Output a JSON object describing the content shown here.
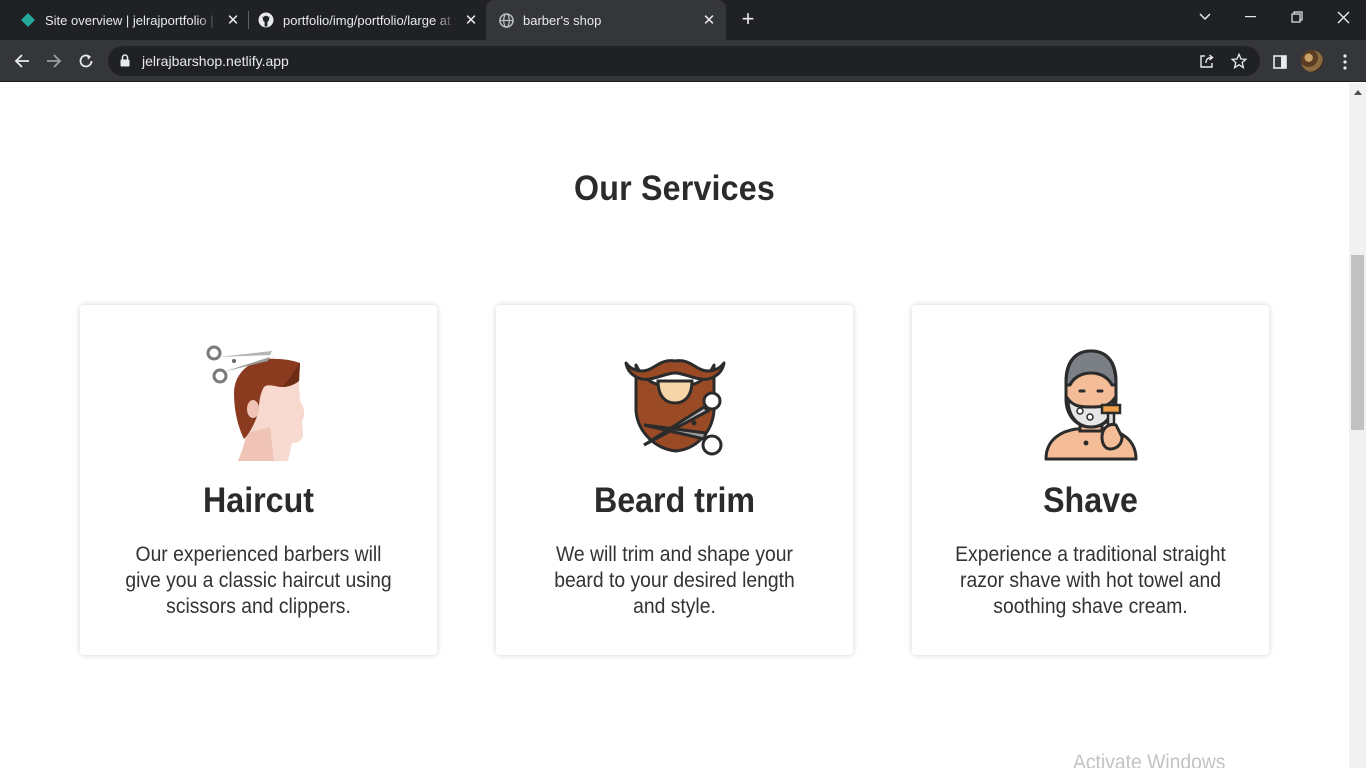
{
  "browser": {
    "tabs": [
      {
        "title": "Site overview | jelrajportfolio | Netlify",
        "icon": "netlify-icon",
        "active": false
      },
      {
        "title": "portfolio/img/portfolio/large at main",
        "icon": "github-icon",
        "active": false
      },
      {
        "title": "barber's shop",
        "icon": "globe-icon",
        "active": true
      }
    ],
    "url": "jelrajbarshop.netlify.app"
  },
  "services": {
    "title": "Our Services",
    "items": [
      {
        "name": "Haircut",
        "icon": "haircut-icon",
        "description": "Our experienced barbers will give you a classic haircut using scissors and clippers."
      },
      {
        "name": "Beard trim",
        "icon": "beard-trim-icon",
        "description": "We will trim and shape your beard to your desired length and style."
      },
      {
        "name": "Shave",
        "icon": "shave-icon",
        "description": "Experience a traditional straight razor shave with hot towel and soothing shave cream."
      }
    ]
  },
  "overlay": {
    "watermark": "Activate Windows"
  },
  "colors": {
    "heading": "#2b2b2b",
    "chrome_dark": "#202124",
    "chrome_toolbar": "#35363a"
  }
}
